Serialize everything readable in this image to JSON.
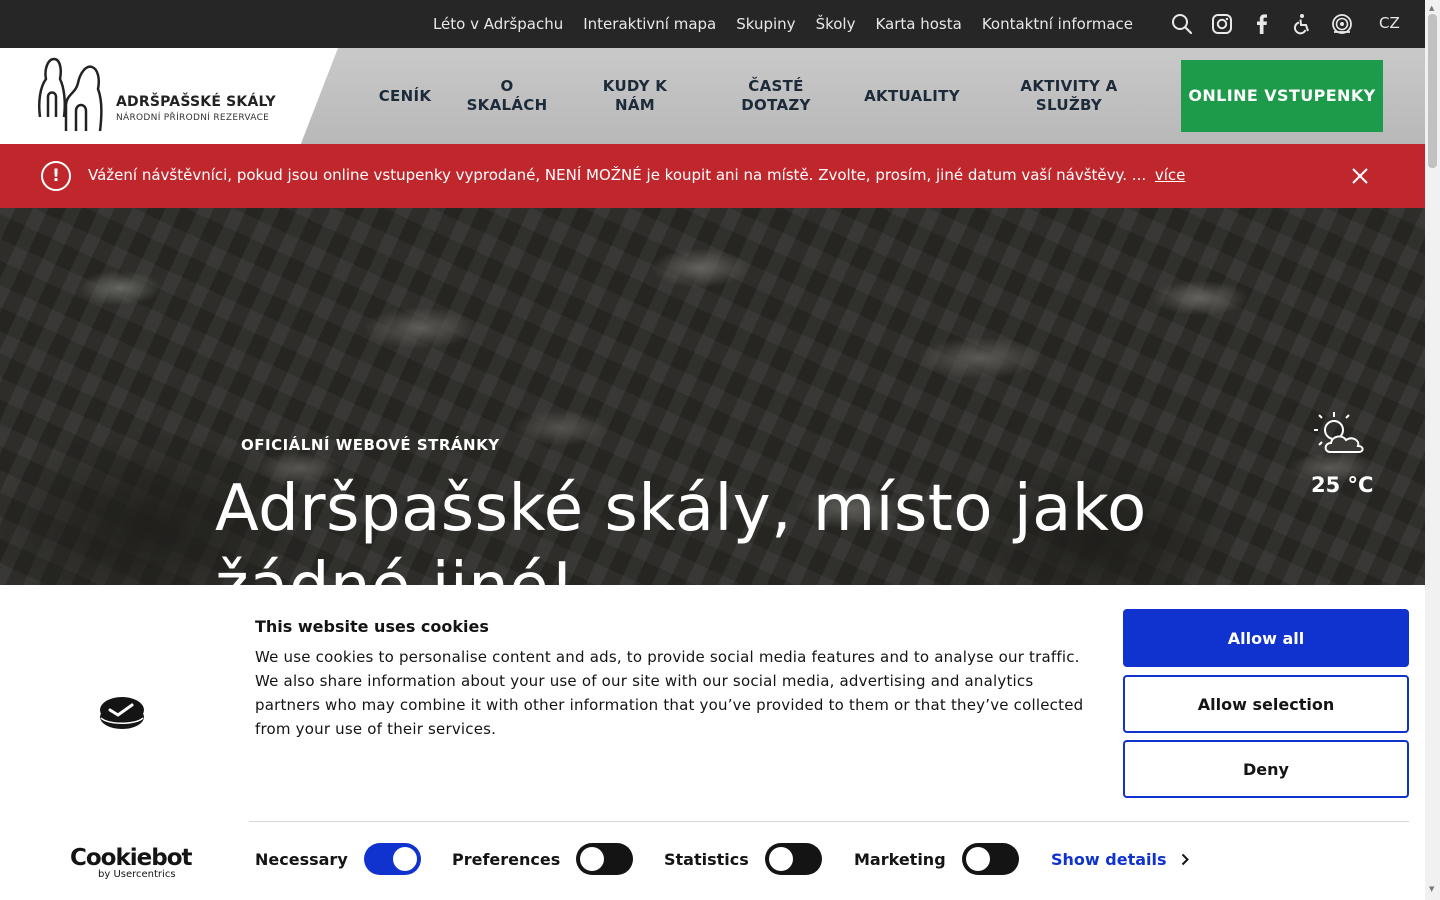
{
  "topbar": {
    "links": [
      "Léto v Adršpachu",
      "Interaktivní mapa",
      "Skupiny",
      "Školy",
      "Karta hosta",
      "Kontaktní informace"
    ],
    "icons": [
      "search-icon",
      "instagram-icon",
      "facebook-icon",
      "accessibility-icon",
      "audio-guide-icon"
    ],
    "language": "CZ"
  },
  "header": {
    "logo_title": "ADRŠPAŠSKÉ SKÁLY",
    "logo_subtitle": "NÁRODNÍ PŘÍRODNÍ REZERVACE",
    "nav": [
      "CENÍK",
      "O SKALÁCH",
      "KUDY K NÁM",
      "ČASTÉ DOTAZY",
      "AKTUALITY",
      "AKTIVITY A SLUŽBY"
    ],
    "cta": "ONLINE VSTUPENKY"
  },
  "alert": {
    "icon": "!",
    "text": "Vážení návštěvníci, pokud jsou online vstupenky vyprodané, NENÍ MOŽNÉ je koupit ani na místě. Zvolte, prosím, jiné datum vaší návštěvy. ...",
    "more": "více"
  },
  "hero": {
    "kicker": "OFICIÁLNÍ WEBOVÉ STRÁNKY",
    "title": "Adršpašské skály, místo jako žádné jiné!",
    "temperature": "25 °C"
  },
  "cookie": {
    "title": "This website uses cookies",
    "text": "We use cookies to personalise content and ads, to provide social media features and to analyse our traffic. We also share information about your use of our site with our social media, advertising and analytics partners who may combine it with other information that you’ve provided to them or that they’ve collected from your use of their services.",
    "buttons": {
      "allow_all": "Allow all",
      "allow_selection": "Allow selection",
      "deny": "Deny"
    },
    "brand": "Cookiebot",
    "brand_sub": "by Usercentrics",
    "toggles": [
      {
        "label": "Necessary",
        "on": true
      },
      {
        "label": "Preferences",
        "on": false
      },
      {
        "label": "Statistics",
        "on": false
      },
      {
        "label": "Marketing",
        "on": false
      }
    ],
    "show_details": "Show details"
  },
  "colors": {
    "cta_green": "#1d9a4a",
    "alert_red": "#c0272d",
    "cookie_blue": "#1032cf"
  }
}
